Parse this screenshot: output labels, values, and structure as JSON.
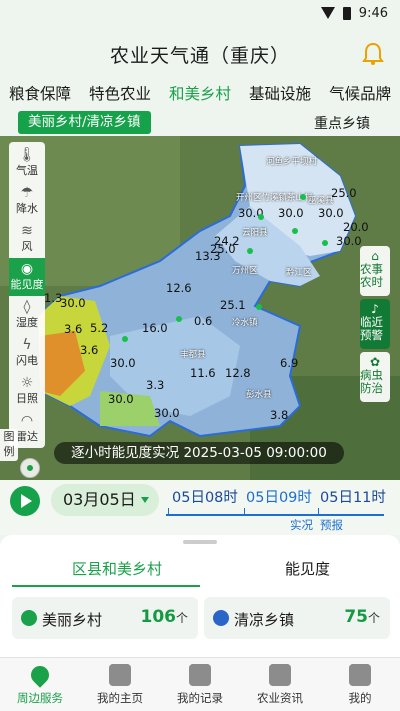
{
  "status": {
    "time": "9:46"
  },
  "header": {
    "title": "农业天气通（重庆）",
    "bell_icon": "bell-icon"
  },
  "tabs": [
    {
      "label": "粮食保障",
      "active": false
    },
    {
      "label": "特色农业",
      "active": false
    },
    {
      "label": "和美乡村",
      "active": true
    },
    {
      "label": "基础设施",
      "active": false
    },
    {
      "label": "气候品牌",
      "active": false
    }
  ],
  "subtabs": {
    "active_pill": "美丽乡村/清凉乡镇",
    "right": "重点乡镇"
  },
  "map_tools": [
    {
      "label": "气温",
      "icon": "thermometer-icon"
    },
    {
      "label": "降水",
      "icon": "rain-icon"
    },
    {
      "label": "风",
      "icon": "wind-icon"
    },
    {
      "label": "能见度",
      "icon": "eye-icon",
      "active": true
    },
    {
      "label": "湿度",
      "icon": "droplet-icon"
    },
    {
      "label": "闪电",
      "icon": "lightning-icon"
    },
    {
      "label": "日照",
      "icon": "sun-icon"
    },
    {
      "label": "雷达",
      "icon": "radar-icon"
    }
  ],
  "legend_tab": "图例",
  "side_buttons": [
    {
      "label": "农事农时",
      "icon": "farm-icon"
    },
    {
      "label": "临近预警",
      "icon": "bell-icon"
    },
    {
      "label": "病虫防治",
      "icon": "bug-icon"
    }
  ],
  "map_values": [
    "25.0",
    "30.0",
    "30.0",
    "30.0",
    "20.0",
    "30.0",
    "24.2",
    "25.0",
    "13.3",
    "30.0",
    "12.6",
    "25.1",
    "1.3",
    "3.6",
    "5.2",
    "0.6",
    "3.6",
    "16.0",
    "30.0",
    "6.9",
    "11.6",
    "12.8",
    "3.3",
    "30.0",
    "3.8",
    "30.0"
  ],
  "map_towns": [
    "河鱼乡平坝村",
    "开州区竹溪镇茶山村",
    "巫溪县",
    "云阳县",
    "万州区",
    "冷水镇",
    "丰都县",
    "彭水县",
    "黔江区"
  ],
  "caption": "逐小时能见度实况 2025-03-05 09:00:00",
  "timeline": {
    "date": "03月05日",
    "slots": [
      "05日08时",
      "05日09时",
      "05日11时"
    ],
    "selected": "05日09时",
    "live_label": "实况",
    "forecast_label": "预报"
  },
  "panel": {
    "tabs": [
      "区县和美乡村",
      "能见度"
    ],
    "cards": [
      {
        "label": "美丽乡村",
        "count": "106",
        "unit": "个",
        "icon": "village-icon",
        "color": "#1aa14a"
      },
      {
        "label": "清凉乡镇",
        "count": "75",
        "unit": "个",
        "icon": "cool-town-icon",
        "color": "#2a66c8"
      }
    ]
  },
  "nav": [
    {
      "label": "周边服务",
      "icon": "location-icon",
      "active": true
    },
    {
      "label": "我的主页",
      "icon": "home-icon"
    },
    {
      "label": "我的记录",
      "icon": "record-icon"
    },
    {
      "label": "农业资讯",
      "icon": "news-icon"
    },
    {
      "label": "我的",
      "icon": "user-icon"
    }
  ]
}
